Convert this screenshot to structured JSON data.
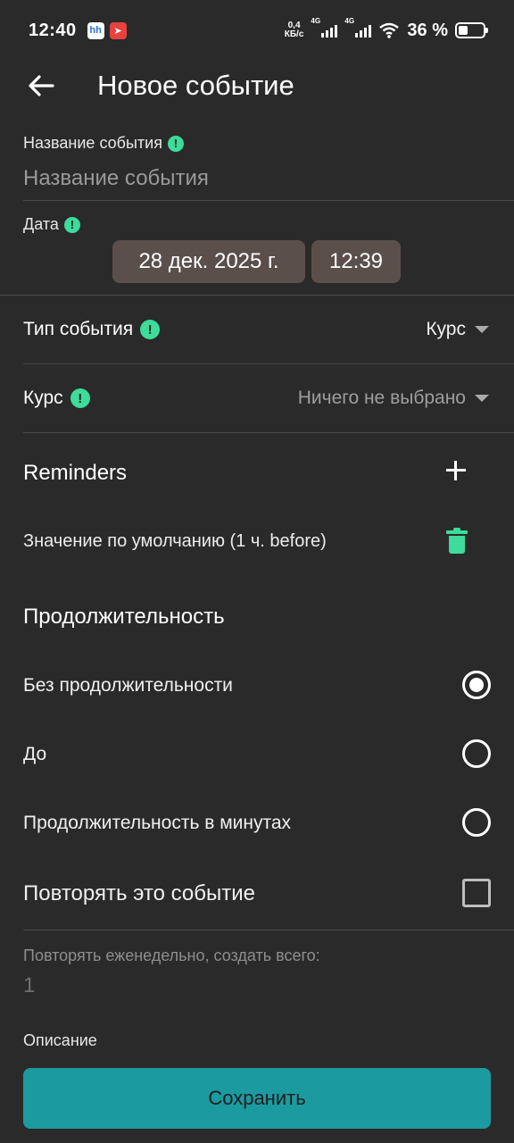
{
  "status_bar": {
    "time": "12:40",
    "speed_value": "0,4",
    "speed_unit": "КБ/с",
    "network_1": "4G",
    "network_2": "4G",
    "battery": "36 %"
  },
  "header": {
    "title": "Новое событие"
  },
  "event_name": {
    "label": "Название события",
    "placeholder": "Название события"
  },
  "date": {
    "label": "Дата",
    "date_value": "28 дек. 2025 г.",
    "time_value": "12:39"
  },
  "event_type": {
    "label": "Тип события",
    "value": "Курс"
  },
  "course": {
    "label": "Курс",
    "value": "Ничего не выбрано"
  },
  "reminders": {
    "title": "Reminders",
    "items": [
      {
        "label": "Значение по умолчанию (1 ч. before)"
      }
    ]
  },
  "duration": {
    "title": "Продолжительность",
    "options": [
      {
        "label": "Без продолжительности",
        "selected": true
      },
      {
        "label": "До",
        "selected": false
      },
      {
        "label": "Продолжительность в минутах",
        "selected": false
      }
    ]
  },
  "repeat": {
    "label": "Повторять это событие",
    "checked": false,
    "weekly_label": "Повторять еженедельно, создать всего:",
    "count": "1"
  },
  "description": {
    "label": "Описание"
  },
  "actions": {
    "save_label": "Сохранить"
  },
  "colors": {
    "background": "#2a2a2a",
    "accent_green": "#3ddc9a",
    "save_button": "#1b9aa0",
    "chip": "#5b4f4c"
  }
}
